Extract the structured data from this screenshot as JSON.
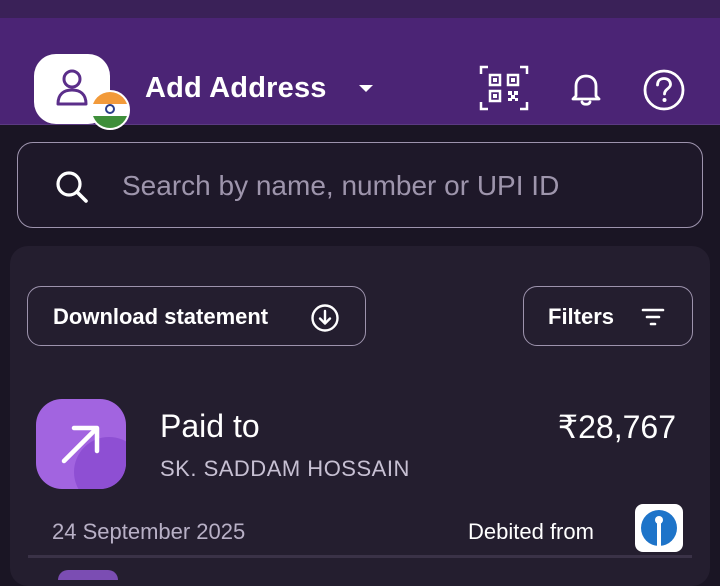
{
  "header": {
    "address_label": "Add Address",
    "icons": [
      "profile-icon",
      "india-flag-icon",
      "caret-down-icon",
      "qr-scan-icon",
      "bell-icon",
      "help-icon"
    ]
  },
  "search": {
    "placeholder": "Search by name, number or UPI ID"
  },
  "actions": {
    "download_label": "Download statement",
    "filters_label": "Filters"
  },
  "transaction": {
    "type": "Paid to",
    "payee": "SK.  SADDAM HOSSAIN",
    "amount": "₹28,767",
    "date": "24 September 2025",
    "debited_label": "Debited from",
    "bank_icon": "sbi-bank-icon"
  },
  "colors": {
    "header_bg": "#4b2475",
    "page_bg": "#1a1524",
    "card_bg": "#241e2f",
    "accent": "#a264e0"
  }
}
